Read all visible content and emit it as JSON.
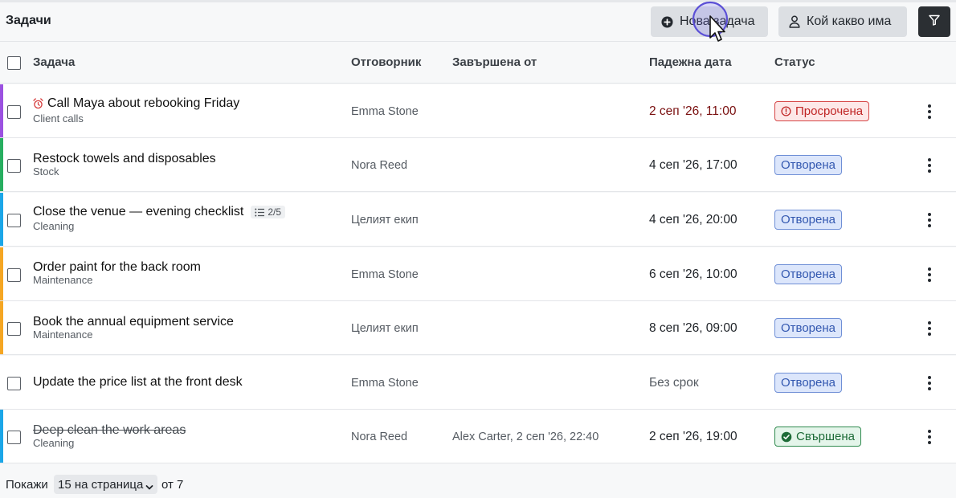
{
  "header": {
    "title": "Задачи",
    "new_task_label": "Нова задача",
    "who_label": "Кой какво има",
    "filter_icon": "filter-icon"
  },
  "table": {
    "columns": {
      "task": "Задача",
      "assignee": "Отговорник",
      "completed_by": "Завършена от",
      "due": "Падежна дата",
      "status": "Статус"
    },
    "rows": [
      {
        "title": "Call Maya about rebooking Friday",
        "category": "Client calls",
        "assignee": "Emma Stone",
        "completed_by": "",
        "due": "2 сеп '26, 11:00",
        "status": "Просрочена",
        "status_type": "overdue",
        "stripe": "#9b51e0",
        "icon": "alarm-icon"
      },
      {
        "title": "Restock towels and disposables",
        "category": "Stock",
        "assignee": "Nora Reed",
        "completed_by": "",
        "due": "4 сеп '26, 17:00",
        "status": "Отворена",
        "status_type": "open",
        "stripe": "#27ae60"
      },
      {
        "title": "Close the venue — evening checklist",
        "category": "Cleaning",
        "assignee": "Целият екип",
        "completed_by": "",
        "due": "4 сеп '26, 20:00",
        "status": "Отворена",
        "status_type": "open",
        "stripe": "#1ba6e8",
        "checklist": "2/5"
      },
      {
        "title": "Order paint for the back room",
        "category": "Maintenance",
        "assignee": "Emma Stone",
        "completed_by": "",
        "due": "6 сеп '26, 10:00",
        "status": "Отворена",
        "status_type": "open",
        "stripe": "#f5a623"
      },
      {
        "title": "Book the annual equipment service",
        "category": "Maintenance",
        "assignee": "Целият екип",
        "completed_by": "",
        "due": "8 сеп '26, 09:00",
        "status": "Отворена",
        "status_type": "open",
        "stripe": "#f5a623"
      },
      {
        "title": "Update the price list at the front desk",
        "category": "",
        "assignee": "Emma Stone",
        "completed_by": "",
        "due": "Без срок",
        "status": "Отворена",
        "status_type": "open",
        "stripe": ""
      },
      {
        "title": "Deep clean the work areas",
        "category": "Cleaning",
        "assignee": "Nora Reed",
        "completed_by": "Alex Carter, 2 сеп '26, 22:40",
        "due": "2 сеп '26, 19:00",
        "status": "Свършена",
        "status_type": "done",
        "stripe": "#1ba6e8"
      }
    ]
  },
  "footer": {
    "show_label": "Покажи",
    "page_size": "15 на страница",
    "of_label": "от 7"
  },
  "colors": {
    "open_badge": "#3358b0",
    "overdue_badge": "#c02626",
    "done_badge": "#1d6b37",
    "cursor_ring": "#5b4fd6"
  }
}
